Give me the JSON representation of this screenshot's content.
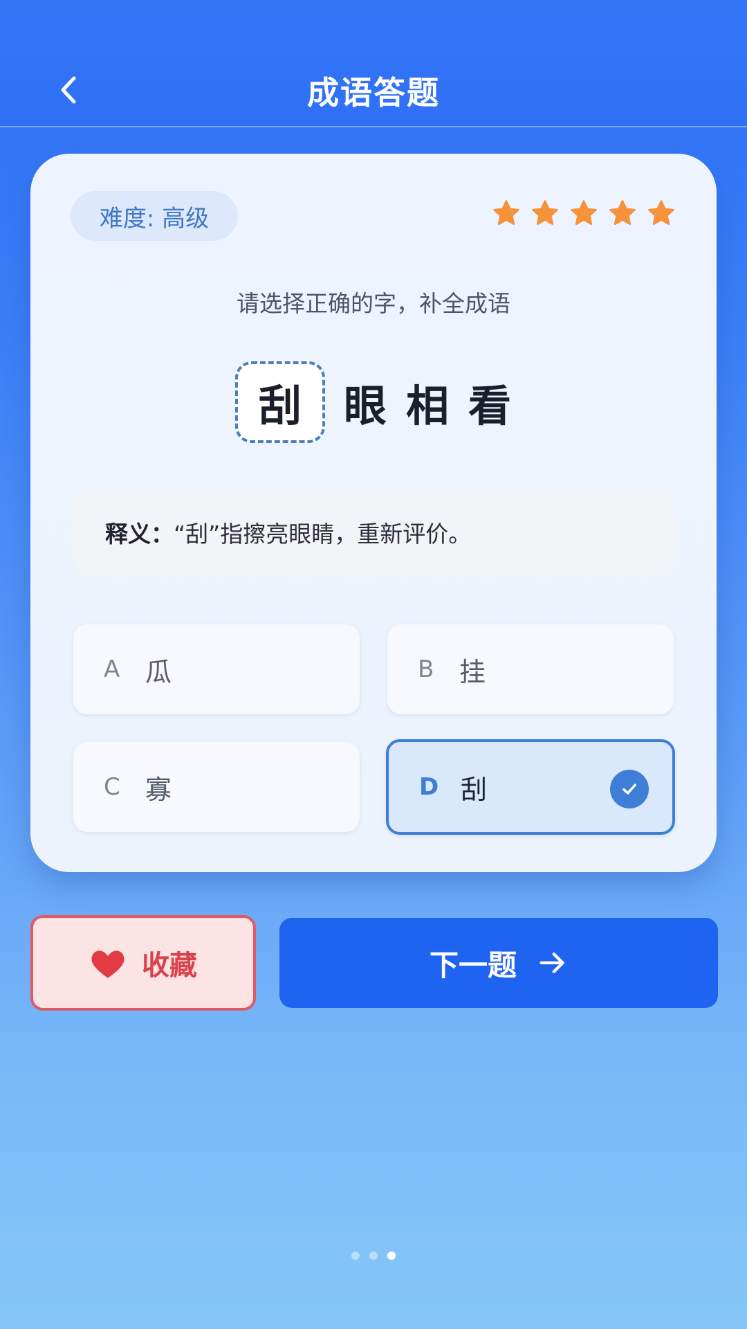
{
  "header": {
    "title": "成语答题"
  },
  "card": {
    "difficulty": "难度: 高级",
    "stars": 5,
    "instruction": "请选择正确的字，补全成语",
    "idiom": {
      "blank": "刮",
      "rest": [
        "眼",
        "相",
        "看"
      ]
    },
    "explanation_label": "释义：",
    "explanation_text": "“刮”指擦亮眼睛，重新评价。",
    "options": [
      {
        "letter": "A",
        "char": "瓜",
        "selected": false
      },
      {
        "letter": "B",
        "char": "挂",
        "selected": false
      },
      {
        "letter": "C",
        "char": "寡",
        "selected": false
      },
      {
        "letter": "D",
        "char": "刮",
        "selected": true
      }
    ]
  },
  "actions": {
    "favorite_label": "收藏",
    "next_label": "下一题"
  },
  "pagination": {
    "current": 3,
    "total": 3
  },
  "colors": {
    "primary": "#1f64f0",
    "accent_star": "#f5923a",
    "favorite": "#d9434e"
  }
}
